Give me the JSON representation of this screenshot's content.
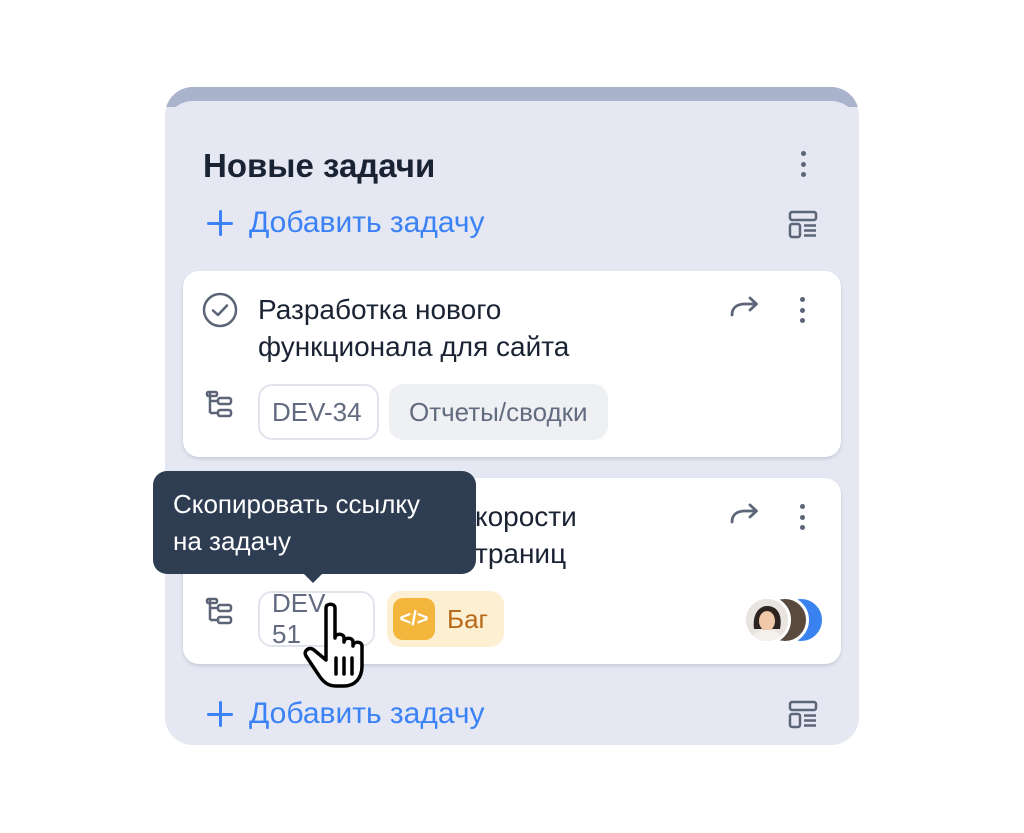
{
  "column": {
    "title": "Новые задачи",
    "add_task_label_top": "Добавить задачу",
    "add_task_label_bottom": "Добавить задачу"
  },
  "cards": [
    {
      "title": "Разработка нового функционала для сайта",
      "id": "DEV-34",
      "category": "Отчеты/сводки"
    },
    {
      "title_visible": "скорости\nстраниц",
      "id": "DEV-51",
      "tag_label": "Баг",
      "tag_icon": "code-icon"
    }
  ],
  "tooltip": {
    "text": "Скопировать ссылку на задачу"
  },
  "colors": {
    "accent": "#3b82f6",
    "column_bg": "#e5e8f2",
    "tooltip_bg": "#2f3d53",
    "bug_tag_bg": "#fcefd2",
    "bug_badge": "#f3b53c"
  }
}
